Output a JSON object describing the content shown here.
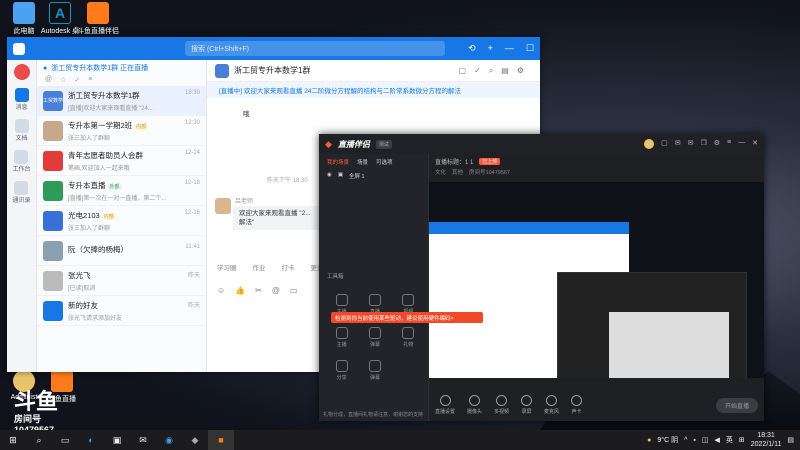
{
  "desktop": {
    "icons": [
      {
        "label": "此电脑"
      },
      {
        "label": "Autodesk 桌"
      },
      {
        "label": "斗鱼直播伴侣"
      }
    ],
    "bottom_icons": [
      {
        "label": "Administ"
      },
      {
        "label": "斗鱼直播"
      }
    ],
    "douyu_badge": {
      "brand": "斗鱼",
      "sub": "房间号",
      "room": "10479567"
    }
  },
  "taskbar": {
    "weather": "9°C 阴",
    "lang": "英",
    "time": "18:31",
    "date": "2022/1/11"
  },
  "dingtalk": {
    "search_placeholder": "搜索 (Ctrl+Shift+F)",
    "rail": [
      "消息",
      "文档",
      "工作台",
      "通讯录"
    ],
    "list_header": "浙工贸专升本数学1群 正在直播",
    "conversations": [
      {
        "name": "浙工贸专升本数学1群",
        "time": "18:30",
        "msg": "[直播]欢迎大家来观看直播 \"24...",
        "avatar_text": "工贸数学",
        "color": "#4a7fd8"
      },
      {
        "name": "专升本第一学期2班",
        "tag": "内部",
        "time": "12:30",
        "msg": "张三加入了群聊",
        "avatar_text": "",
        "color": "#c8a88c"
      },
      {
        "name": "青年志愿者助员人会群",
        "time": "12-24",
        "msg": "笔画,欢迎加入一起来哦",
        "avatar_text": "",
        "color": "#e23b3b"
      },
      {
        "name": "专升本直播",
        "tag": "外部",
        "time": "12-18",
        "msg": "[直播]第一次在一对一直播，第二个...",
        "avatar_text": "",
        "color": "#2f9b5a"
      },
      {
        "name": "光电2103",
        "tag": "内部",
        "time": "12-16",
        "msg": "张三加入了群聊",
        "avatar_text": "",
        "color": "#3a6fd8"
      },
      {
        "name": "阮（欠捧的杨梅）",
        "time": "11:41",
        "msg": "",
        "avatar_text": "",
        "color": "#8aa0b0"
      },
      {
        "name": "张光飞",
        "time": "昨天",
        "msg": "[已读]取消",
        "avatar_text": "",
        "color": "#bbbbbb"
      },
      {
        "name": "新的好友",
        "time": "昨天",
        "msg": "张光飞请求添加好友",
        "avatar_text": "",
        "color": "#1677e5"
      }
    ],
    "chat": {
      "title": "浙工贸专升本数学1群",
      "banner": "[直播中] 欢迎大家来观看直播 24二阶微分方程解的结构与二阶常系数微分方程的解法",
      "msg1": "哦",
      "time_divider": "昨天下午 18:30",
      "sender": "吕老师",
      "msg2": "欢迎大家来观看直播 \"2...",
      "msg2b": "解法\"",
      "tools": [
        "学习圈",
        "作业",
        "打卡",
        "更多"
      ]
    }
  },
  "live": {
    "title": "直播伴侣",
    "beta": "测试",
    "scene_tabs": [
      "我的场景",
      "场景",
      "可选项"
    ],
    "scene_name": "全屏 1",
    "room_title": "直播标题：1 1",
    "room_badge": "已上传",
    "room_sub": [
      "文化",
      "其他",
      "房间号10479567"
    ],
    "tools": [
      "工具箱",
      "主播",
      "直播",
      "视频",
      "主播",
      "弹幕",
      "礼物",
      "分享",
      "弹幕"
    ],
    "toast": "检测到你当前使用某些驱动，建议使用硬件编码×",
    "footer": "礼物分成，直播间礼物请注意，谢谢您的支持",
    "bottom_tools": [
      "直播设置",
      "摄像头",
      "多视频",
      "录屏",
      "麦克风",
      "声卡"
    ],
    "go_live": "开始直播"
  },
  "colors": {
    "dingtalk_blue": "#1677e5",
    "live_accent": "#ff5a3c"
  }
}
